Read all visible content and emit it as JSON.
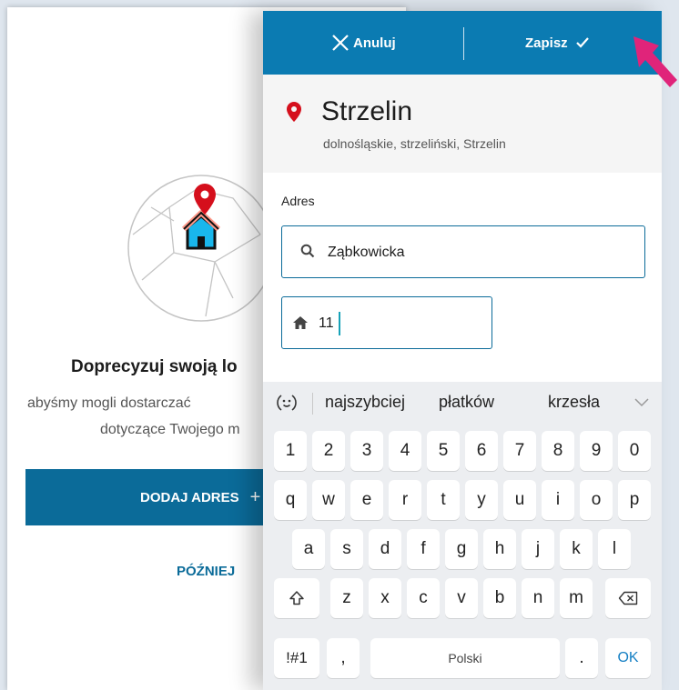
{
  "background_screen": {
    "title": "Doprecyzuj swoją lo",
    "description_line1": "abyśmy mogli dostarczać",
    "description_line2": "dotyczące Twojego m",
    "add_address_button": "DODAJ ADRES",
    "add_address_plus": "+",
    "later_link": "PÓŹNIEJ"
  },
  "top_bar": {
    "cancel_label": "Anuluj",
    "save_label": "Zapisz",
    "background_color": "#0b7bb2"
  },
  "location": {
    "city": "Strzelin",
    "region": "dolnośląskie, strzeliński, Strzelin"
  },
  "form": {
    "address_label": "Adres",
    "street_value": "Ząbkowicka",
    "house_number_value": "11"
  },
  "keyboard": {
    "suggestions": [
      "najszybciej",
      "płatków",
      "krzesła"
    ],
    "row_numbers": [
      "1",
      "2",
      "3",
      "4",
      "5",
      "6",
      "7",
      "8",
      "9",
      "0"
    ],
    "row_top": [
      "q",
      "w",
      "e",
      "r",
      "t",
      "y",
      "u",
      "i",
      "o",
      "p"
    ],
    "row_mid": [
      "a",
      "s",
      "d",
      "f",
      "g",
      "h",
      "j",
      "k",
      "l"
    ],
    "row_bottom": [
      "z",
      "x",
      "c",
      "v",
      "b",
      "n",
      "m"
    ],
    "symbols_key": "!#1",
    "comma_key": ",",
    "space_label": "Polski",
    "period_key": ".",
    "ok_key": "OK"
  },
  "colors": {
    "accent": "#0b6b99",
    "pin_red": "#d50f1c",
    "caret": "#17a2b8",
    "arrow_pink": "#e0247a"
  }
}
